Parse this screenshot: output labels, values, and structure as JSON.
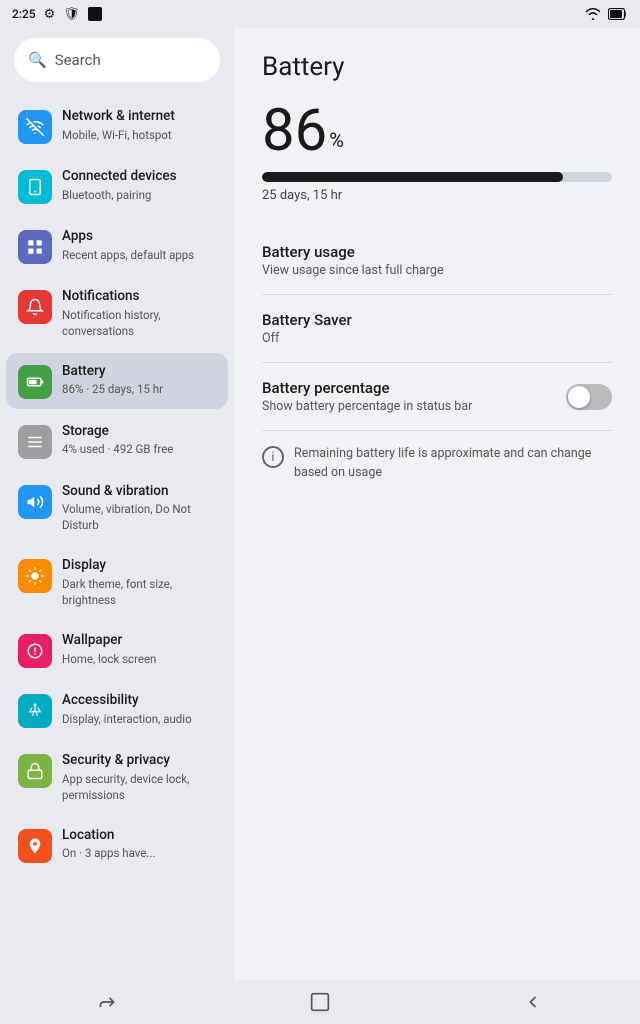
{
  "statusBar": {
    "time": "2:25",
    "icons": [
      "settings",
      "shield",
      "square"
    ],
    "rightIcons": [
      "wifi",
      "battery"
    ]
  },
  "sidebar": {
    "search": {
      "placeholder": "Search"
    },
    "items": [
      {
        "id": "network",
        "title": "Network & internet",
        "subtitle": "Mobile, Wi-Fi, hotspot",
        "iconColor": "blue",
        "icon": "📶"
      },
      {
        "id": "connected",
        "title": "Connected devices",
        "subtitle": "Bluetooth, pairing",
        "iconColor": "teal",
        "icon": "📱"
      },
      {
        "id": "apps",
        "title": "Apps",
        "subtitle": "Recent apps, default apps",
        "iconColor": "indigo",
        "icon": "⊞"
      },
      {
        "id": "notifications",
        "title": "Notifications",
        "subtitle": "Notification history, conversations",
        "iconColor": "red",
        "icon": "🔔"
      },
      {
        "id": "battery",
        "title": "Battery",
        "subtitle": "86% · 25 days, 15 hr",
        "iconColor": "green",
        "icon": "🔋",
        "active": true
      },
      {
        "id": "storage",
        "title": "Storage",
        "subtitle": "4% used · 492 GB free",
        "iconColor": "gray",
        "icon": "☰"
      },
      {
        "id": "sound",
        "title": "Sound & vibration",
        "subtitle": "Volume, vibration, Do Not Disturb",
        "iconColor": "blue",
        "icon": "🔊"
      },
      {
        "id": "display",
        "title": "Display",
        "subtitle": "Dark theme, font size, brightness",
        "iconColor": "orange",
        "icon": "☀"
      },
      {
        "id": "wallpaper",
        "title": "Wallpaper",
        "subtitle": "Home, lock screen",
        "iconColor": "pink",
        "icon": "❀"
      },
      {
        "id": "accessibility",
        "title": "Accessibility",
        "subtitle": "Display, interaction, audio",
        "iconColor": "cyan",
        "icon": "👁"
      },
      {
        "id": "security",
        "title": "Security & privacy",
        "subtitle": "App security, device lock, permissions",
        "iconColor": "lime",
        "icon": "🔒"
      },
      {
        "id": "location",
        "title": "Location",
        "subtitle": "On · 3 apps have...",
        "iconColor": "deep-orange",
        "icon": "📍"
      }
    ]
  },
  "content": {
    "title": "Battery",
    "percentage": "86",
    "percentSymbol": "%",
    "progressValue": 86,
    "timeRemaining": "25 days, 15 hr",
    "settings": [
      {
        "id": "battery-usage",
        "title": "Battery usage",
        "subtitle": "View usage since last full charge",
        "hasToggle": false
      },
      {
        "id": "battery-saver",
        "title": "Battery Saver",
        "subtitle": "Off",
        "hasToggle": false
      },
      {
        "id": "battery-percentage",
        "title": "Battery percentage",
        "subtitle": "Show battery percentage in status bar",
        "hasToggle": true,
        "toggleState": "off"
      }
    ],
    "infoText": "Remaining battery life is approximate and can change based on usage"
  },
  "bottomNav": {
    "back": "←",
    "home": "□",
    "recent": "→"
  }
}
